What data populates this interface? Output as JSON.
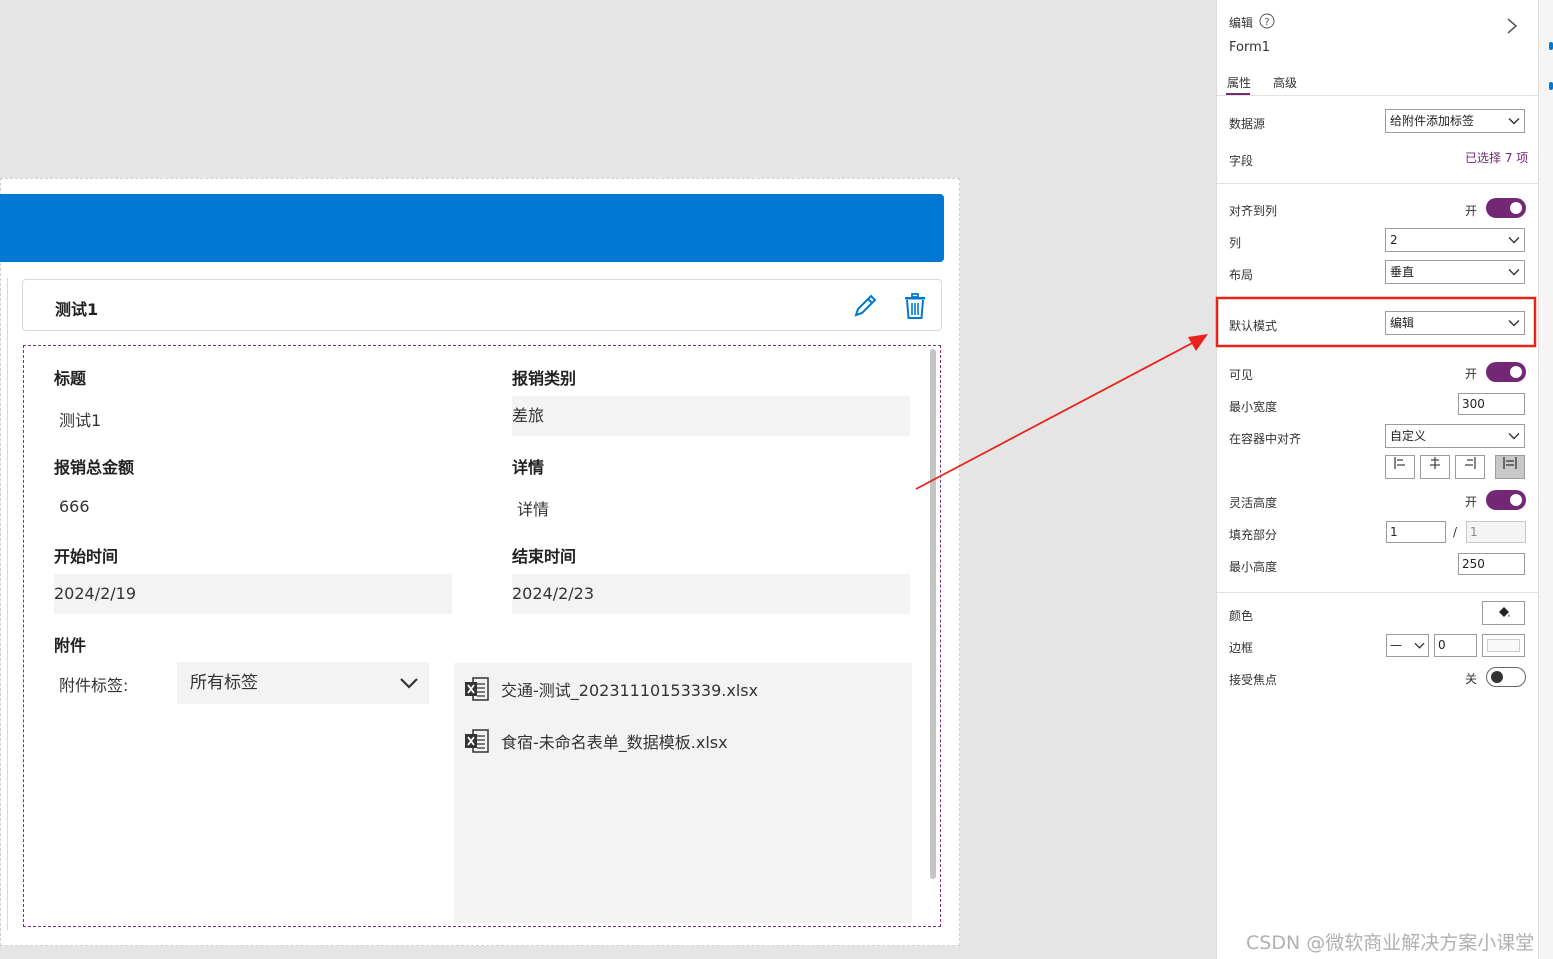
{
  "form": {
    "card_title": "测试1",
    "fields": {
      "title_label": "标题",
      "title_value": "测试1",
      "category_label": "报销类别",
      "category_value": "差旅",
      "amount_label": "报销总金额",
      "amount_value": "666",
      "detail_label": "详情",
      "detail_value": "详情",
      "start_label": "开始时间",
      "start_value": "2024/2/19",
      "end_label": "结束时间",
      "end_value": "2024/2/23",
      "attachment_label": "附件"
    },
    "attachment_tag_label": "附件标签:",
    "attachment_tag_value": "所有标签",
    "attachments": [
      "交通-测试_20231110153339.xlsx",
      "食宿-未命名表单_数据模板.xlsx"
    ]
  },
  "panel": {
    "mode_label": "编辑",
    "control_name": "Form1",
    "tabs": [
      "属性",
      "高级"
    ],
    "data_source_label": "数据源",
    "data_source_value": "给附件添加标签",
    "fields_label": "字段",
    "fields_value": "已选择 7 项",
    "snap_label": "对齐到列",
    "snap_state": "开",
    "columns_label": "列",
    "columns_value": "2",
    "layout_label": "布局",
    "layout_value": "垂直",
    "default_mode_label": "默认模式",
    "default_mode_value": "编辑",
    "visible_label": "可见",
    "visible_state": "开",
    "min_width_label": "最小宽度",
    "min_width_value": "300",
    "align_label": "在容器中对齐",
    "align_value": "自定义",
    "flex_height_label": "灵活高度",
    "flex_height_state": "开",
    "fill_label": "填充部分",
    "fill_value": "1",
    "fill_sep": "/",
    "fill_total": "1",
    "min_height_label": "最小高度",
    "min_height_value": "250",
    "color_label": "颜色",
    "border_label": "边框",
    "border_style": "—",
    "border_width": "0",
    "focus_label": "接受焦点",
    "focus_state": "关"
  },
  "watermark": "CSDN @微软商业解决方案小课堂",
  "colors": {
    "header": "#0078d4",
    "accent": "#742774",
    "highlight": "#e8231a"
  }
}
